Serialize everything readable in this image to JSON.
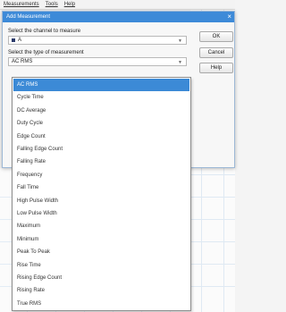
{
  "menu": {
    "items": [
      "Measurements",
      "Tools",
      "Help"
    ]
  },
  "dialog": {
    "title": "Add Measurement",
    "close_glyph": "×",
    "channel_label": "Select the channel to measure",
    "channel_value": "A",
    "type_label": "Select the type of measurement",
    "type_value": "AC RMS",
    "buttons": {
      "ok": "OK",
      "cancel": "Cancel",
      "help": "Help"
    }
  },
  "dropdown": {
    "selected_index": 0,
    "options": [
      "AC RMS",
      "Cycle Time",
      "DC Average",
      "Duty Cycle",
      "Edge Count",
      "Falling Edge Count",
      "Falling Rate",
      "Frequency",
      "Fall Time",
      "High Pulse Width",
      "Low Pulse Width",
      "Maximum",
      "Minimum",
      "Peak To Peak",
      "Rise Time",
      "Rising Edge Count",
      "Rising Rate",
      "True RMS"
    ]
  },
  "colors": {
    "titlebar": "#3d8ad8",
    "selection": "#3c8ad6",
    "channel_a": "#2a3a6a"
  }
}
